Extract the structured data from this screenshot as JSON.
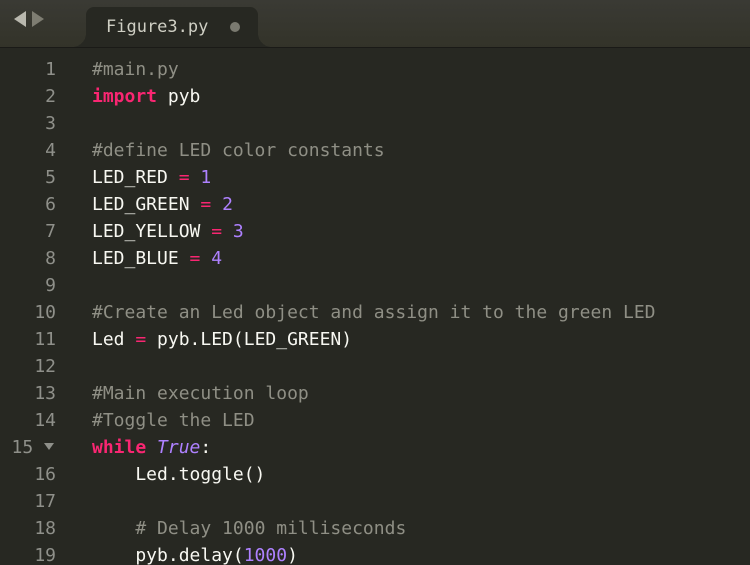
{
  "tab": {
    "filename": "Figure3.py",
    "modified": true
  },
  "nav": {
    "back_label": "back",
    "forward_label": "forward"
  },
  "gutter": {
    "lines": [
      "1",
      "2",
      "3",
      "4",
      "5",
      "6",
      "7",
      "8",
      "9",
      "10",
      "11",
      "12",
      "13",
      "14",
      "15",
      "16",
      "17",
      "18",
      "19"
    ],
    "fold_line": "15"
  },
  "code": {
    "1": {
      "tokens": [
        {
          "cls": "c-comment",
          "t": "#main.py"
        }
      ]
    },
    "2": {
      "tokens": [
        {
          "cls": "c-kw",
          "t": "import"
        },
        {
          "cls": "c-plain",
          "t": " pyb"
        }
      ]
    },
    "3": {
      "tokens": []
    },
    "4": {
      "tokens": [
        {
          "cls": "c-comment",
          "t": "#define LED color constants"
        }
      ]
    },
    "5": {
      "tokens": [
        {
          "cls": "c-plain",
          "t": "LED_RED "
        },
        {
          "cls": "c-op",
          "t": "="
        },
        {
          "cls": "c-plain",
          "t": " "
        },
        {
          "cls": "c-num",
          "t": "1"
        }
      ]
    },
    "6": {
      "tokens": [
        {
          "cls": "c-plain",
          "t": "LED_GREEN "
        },
        {
          "cls": "c-op",
          "t": "="
        },
        {
          "cls": "c-plain",
          "t": " "
        },
        {
          "cls": "c-num",
          "t": "2"
        }
      ]
    },
    "7": {
      "tokens": [
        {
          "cls": "c-plain",
          "t": "LED_YELLOW "
        },
        {
          "cls": "c-op",
          "t": "="
        },
        {
          "cls": "c-plain",
          "t": " "
        },
        {
          "cls": "c-num",
          "t": "3"
        }
      ]
    },
    "8": {
      "tokens": [
        {
          "cls": "c-plain",
          "t": "LED_BLUE "
        },
        {
          "cls": "c-op",
          "t": "="
        },
        {
          "cls": "c-plain",
          "t": " "
        },
        {
          "cls": "c-num",
          "t": "4"
        }
      ]
    },
    "9": {
      "tokens": []
    },
    "10": {
      "tokens": [
        {
          "cls": "c-comment",
          "t": "#Create an Led object and assign it to the green LED"
        }
      ]
    },
    "11": {
      "tokens": [
        {
          "cls": "c-plain",
          "t": "Led "
        },
        {
          "cls": "c-op",
          "t": "="
        },
        {
          "cls": "c-plain",
          "t": " pyb.LED(LED_GREEN)"
        }
      ]
    },
    "12": {
      "tokens": []
    },
    "13": {
      "tokens": [
        {
          "cls": "c-comment",
          "t": "#Main execution loop"
        }
      ]
    },
    "14": {
      "tokens": [
        {
          "cls": "c-comment",
          "t": "#Toggle the LED"
        }
      ]
    },
    "15": {
      "tokens": [
        {
          "cls": "c-kw",
          "t": "while"
        },
        {
          "cls": "c-plain",
          "t": " "
        },
        {
          "cls": "c-builtin",
          "t": "True"
        },
        {
          "cls": "c-plain",
          "t": ":"
        }
      ]
    },
    "16": {
      "tokens": [
        {
          "cls": "c-plain",
          "t": "    Led.toggle()"
        }
      ]
    },
    "17": {
      "tokens": []
    },
    "18": {
      "tokens": [
        {
          "cls": "c-plain",
          "t": "    "
        },
        {
          "cls": "c-comment",
          "t": "# Delay 1000 milliseconds"
        }
      ]
    },
    "19": {
      "tokens": [
        {
          "cls": "c-plain",
          "t": "    pyb.delay("
        },
        {
          "cls": "c-num",
          "t": "1000"
        },
        {
          "cls": "c-plain",
          "t": ")"
        }
      ]
    }
  }
}
